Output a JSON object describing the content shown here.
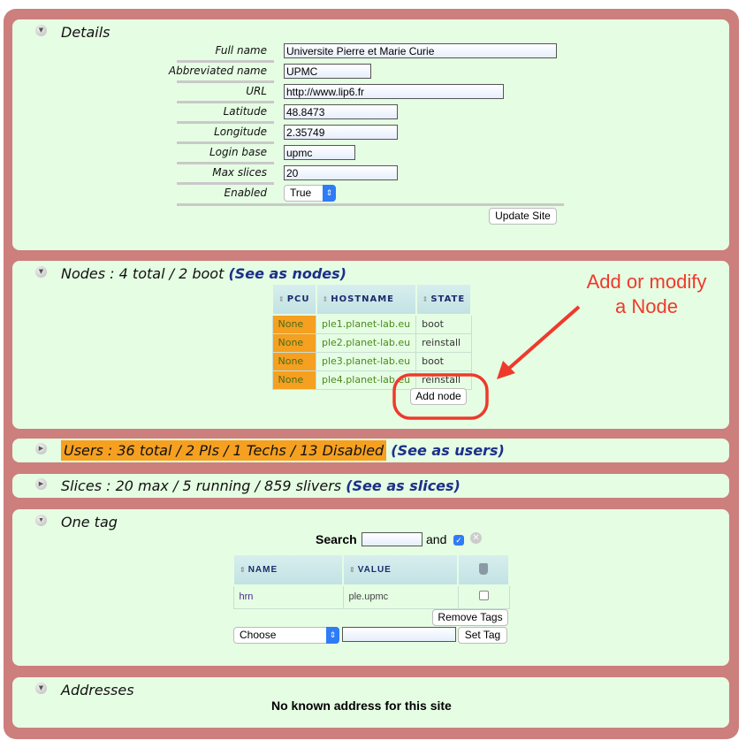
{
  "details": {
    "title": "Details",
    "fields": [
      {
        "label": "Full name",
        "value": "Universite Pierre et Marie Curie"
      },
      {
        "label": "Abbreviated name",
        "value": "UPMC"
      },
      {
        "label": "URL",
        "value": "http://www.lip6.fr"
      },
      {
        "label": "Latitude",
        "value": "48.8473"
      },
      {
        "label": "Longitude",
        "value": "2.35749"
      },
      {
        "label": "Login base",
        "value": "upmc"
      },
      {
        "label": "Max slices",
        "value": "20"
      }
    ],
    "enabled_label": "Enabled",
    "enabled_value": "True",
    "update_label": "Update Site"
  },
  "nodes": {
    "title": "Nodes : 4 total / 2 boot",
    "link": "(See as nodes)",
    "columns": [
      "PCU",
      "HOSTNAME",
      "STATE"
    ],
    "rows": [
      {
        "pcu": "None",
        "hostname": "ple1.planet-lab.eu",
        "state": "boot"
      },
      {
        "pcu": "None",
        "hostname": "ple2.planet-lab.eu",
        "state": "reinstall"
      },
      {
        "pcu": "None",
        "hostname": "ple3.planet-lab.eu",
        "state": "boot"
      },
      {
        "pcu": "None",
        "hostname": "ple4.planet-lab.eu",
        "state": "reinstall"
      }
    ],
    "add_label": "Add node"
  },
  "annotation": {
    "line1": "Add or modify",
    "line2": "a Node",
    "color": "#ee3a2c"
  },
  "users": {
    "title": "Users : 36 total / 2 PIs / 1 Techs / 13 Disabled",
    "link": "(See as users)",
    "highlight": "#f5a020"
  },
  "slices": {
    "title": "Slices : 20 max / 5 running / 859 slivers",
    "link": "(See as slices)"
  },
  "tags": {
    "title": "One tag",
    "search_label": "Search",
    "search_value": "",
    "and_label": "and",
    "columns": [
      "NAME",
      "VALUE"
    ],
    "rows": [
      {
        "name": "hrn",
        "value": "ple.upmc"
      }
    ],
    "remove_label": "Remove Tags",
    "choose_value": "Choose",
    "tag_value": "",
    "set_label": "Set Tag"
  },
  "addresses": {
    "title": "Addresses",
    "empty": "No known address for this site"
  },
  "colors": {
    "border": "#cc7f7c",
    "panel": "#e5fde3",
    "link": "#1d2f8a"
  }
}
